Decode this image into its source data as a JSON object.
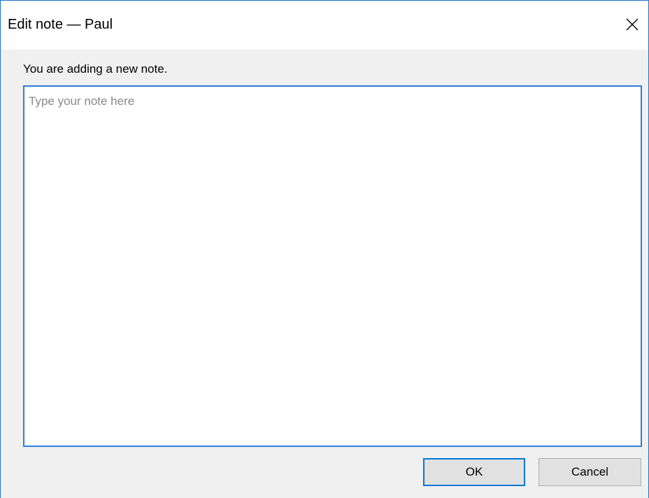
{
  "window": {
    "title": "Edit note — Paul",
    "close_icon": "close-icon"
  },
  "dialog": {
    "prompt": "You are adding a new note.",
    "note_value": "",
    "note_placeholder": "Type your note here"
  },
  "buttons": {
    "ok_label": "OK",
    "cancel_label": "Cancel"
  },
  "colors": {
    "accent": "#0078d7",
    "window_border": "#1a73c8",
    "background": "#f0f0f0",
    "titlebar": "#ffffff",
    "button_face": "#e1e1e1"
  }
}
